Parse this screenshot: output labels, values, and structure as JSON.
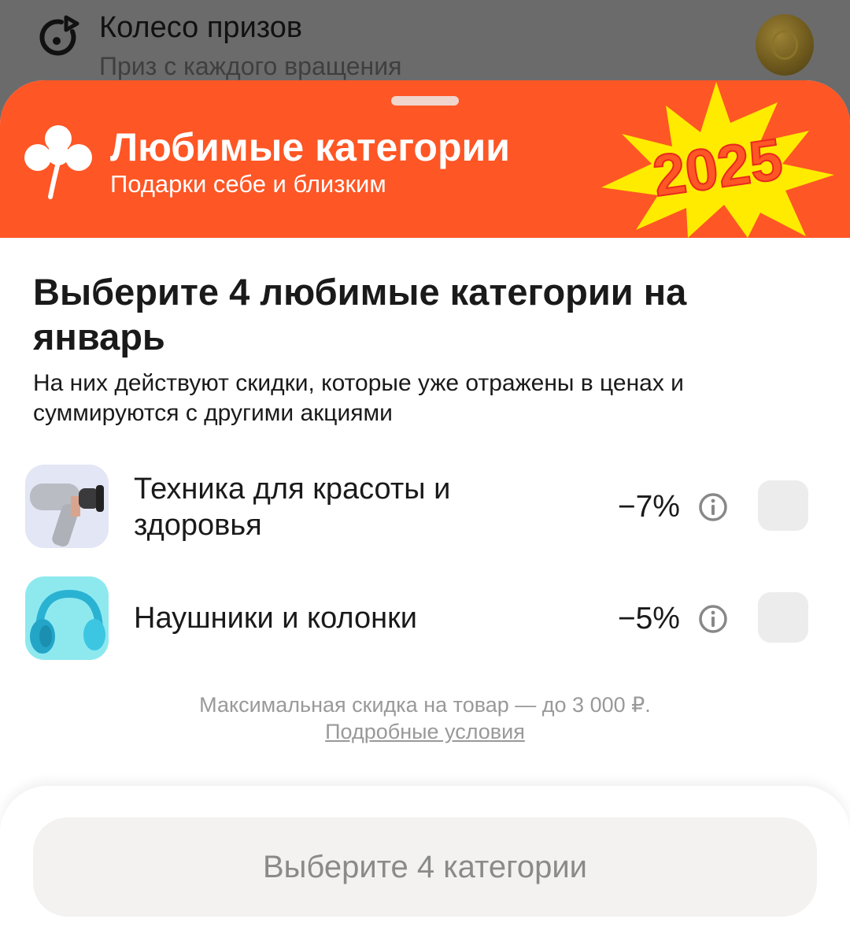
{
  "background": {
    "title": "Колесо призов",
    "subtitle": "Приз с каждого вращения"
  },
  "banner": {
    "title": "Любимые категории",
    "subtitle": "Подарки себе и близким",
    "year_badge": "2025"
  },
  "heading": "Выберите 4 любимые категории на январь",
  "description": "На них действуют скидки, которые уже отражены в ценах и суммируются с другими акциями",
  "categories": [
    {
      "name": "Техника для красоты и здоровья",
      "discount": "−7%",
      "selected": false
    },
    {
      "name": "Наушники и колонки",
      "discount": "−5%",
      "selected": false
    }
  ],
  "note": {
    "text": "Максимальная скидка на товар — до 3 000 ₽.",
    "link": "Подробные условия"
  },
  "cta_label": "Выберите 4 категории",
  "colors": {
    "brand_orange": "#fe5625",
    "burst_yellow": "#ffeb00"
  }
}
